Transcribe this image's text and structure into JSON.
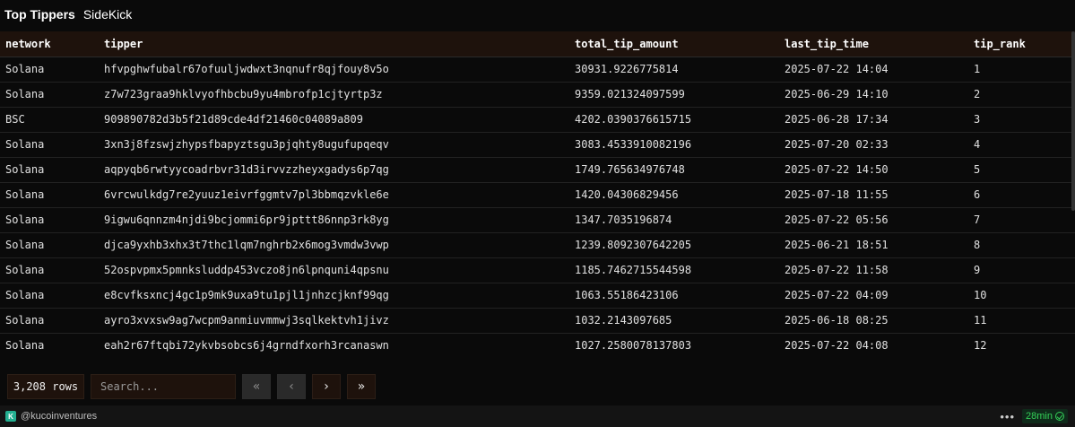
{
  "header": {
    "title": "Top Tippers",
    "subtitle": "SideKick"
  },
  "table": {
    "columns": [
      "network",
      "tipper",
      "total_tip_amount",
      "last_tip_time",
      "tip_rank"
    ],
    "rows": [
      [
        "Solana",
        "hfvpghwfubalr67ofuuljwdwxt3nqnufr8qjfouy8v5o",
        "30931.9226775814",
        "2025-07-22 14:04",
        "1"
      ],
      [
        "Solana",
        "z7w723graa9hklvyofhbcbu9yu4mbrofp1cjtyrtp3z",
        "9359.021324097599",
        "2025-06-29 14:10",
        "2"
      ],
      [
        "BSC",
        "909890782d3b5f21d89cde4df21460c04089a809",
        "4202.0390376615715",
        "2025-06-28 17:34",
        "3"
      ],
      [
        "Solana",
        "3xn3j8fzswjzhypsfbapyztsgu3pjqhty8ugufupqeqv",
        "3083.4533910082196",
        "2025-07-20 02:33",
        "4"
      ],
      [
        "Solana",
        "aqpyqb6rwtyycoadrbvr31d3irvvzzheyxgadys6p7qg",
        "1749.765634976748",
        "2025-07-22 14:50",
        "5"
      ],
      [
        "Solana",
        "6vrcwulkdg7re2yuuz1eivrfggmtv7pl3bbmqzvkle6e",
        "1420.04306829456",
        "2025-07-18 11:55",
        "6"
      ],
      [
        "Solana",
        "9igwu6qnnzm4njdi9bcjommi6pr9jpttt86nnp3rk8yg",
        "1347.7035196874",
        "2025-07-22 05:56",
        "7"
      ],
      [
        "Solana",
        "djca9yxhb3xhx3t7thc1lqm7nghrb2x6mog3vmdw3vwp",
        "1239.8092307642205",
        "2025-06-21 18:51",
        "8"
      ],
      [
        "Solana",
        "52ospvpmx5pmnksluddp453vczo8jn6lpnquni4qpsnu",
        "1185.7462715544598",
        "2025-07-22 11:58",
        "9"
      ],
      [
        "Solana",
        "e8cvfksxncj4gc1p9mk9uxa9tu1pjl1jnhzcjknf99qg",
        "1063.55186423106",
        "2025-07-22 04:09",
        "10"
      ],
      [
        "Solana",
        "ayro3xvxsw9ag7wcpm9anmiuvmmwj3sqlkektvh1jivz",
        "1032.2143097685",
        "2025-06-18 08:25",
        "11"
      ],
      [
        "Solana",
        "eah2r67ftqbi72ykvbsobcs6j4grndfxorh3rcanaswn",
        "1027.2580078137803",
        "2025-07-22 04:08",
        "12"
      ]
    ]
  },
  "pager": {
    "row_count": "3,208 rows",
    "search_placeholder": "Search...",
    "first_icon": "double-chevron-left-icon",
    "prev_icon": "chevron-left-icon",
    "next_icon": "chevron-right-icon",
    "last_icon": "double-chevron-right-icon"
  },
  "footer": {
    "credit": "@kucoinventures",
    "menu_icon": "more-dots-icon",
    "freshness": "28min"
  },
  "colors": {
    "background": "#0a0a0a",
    "header_row": "#1e120c",
    "accent_green": "#34d058"
  }
}
